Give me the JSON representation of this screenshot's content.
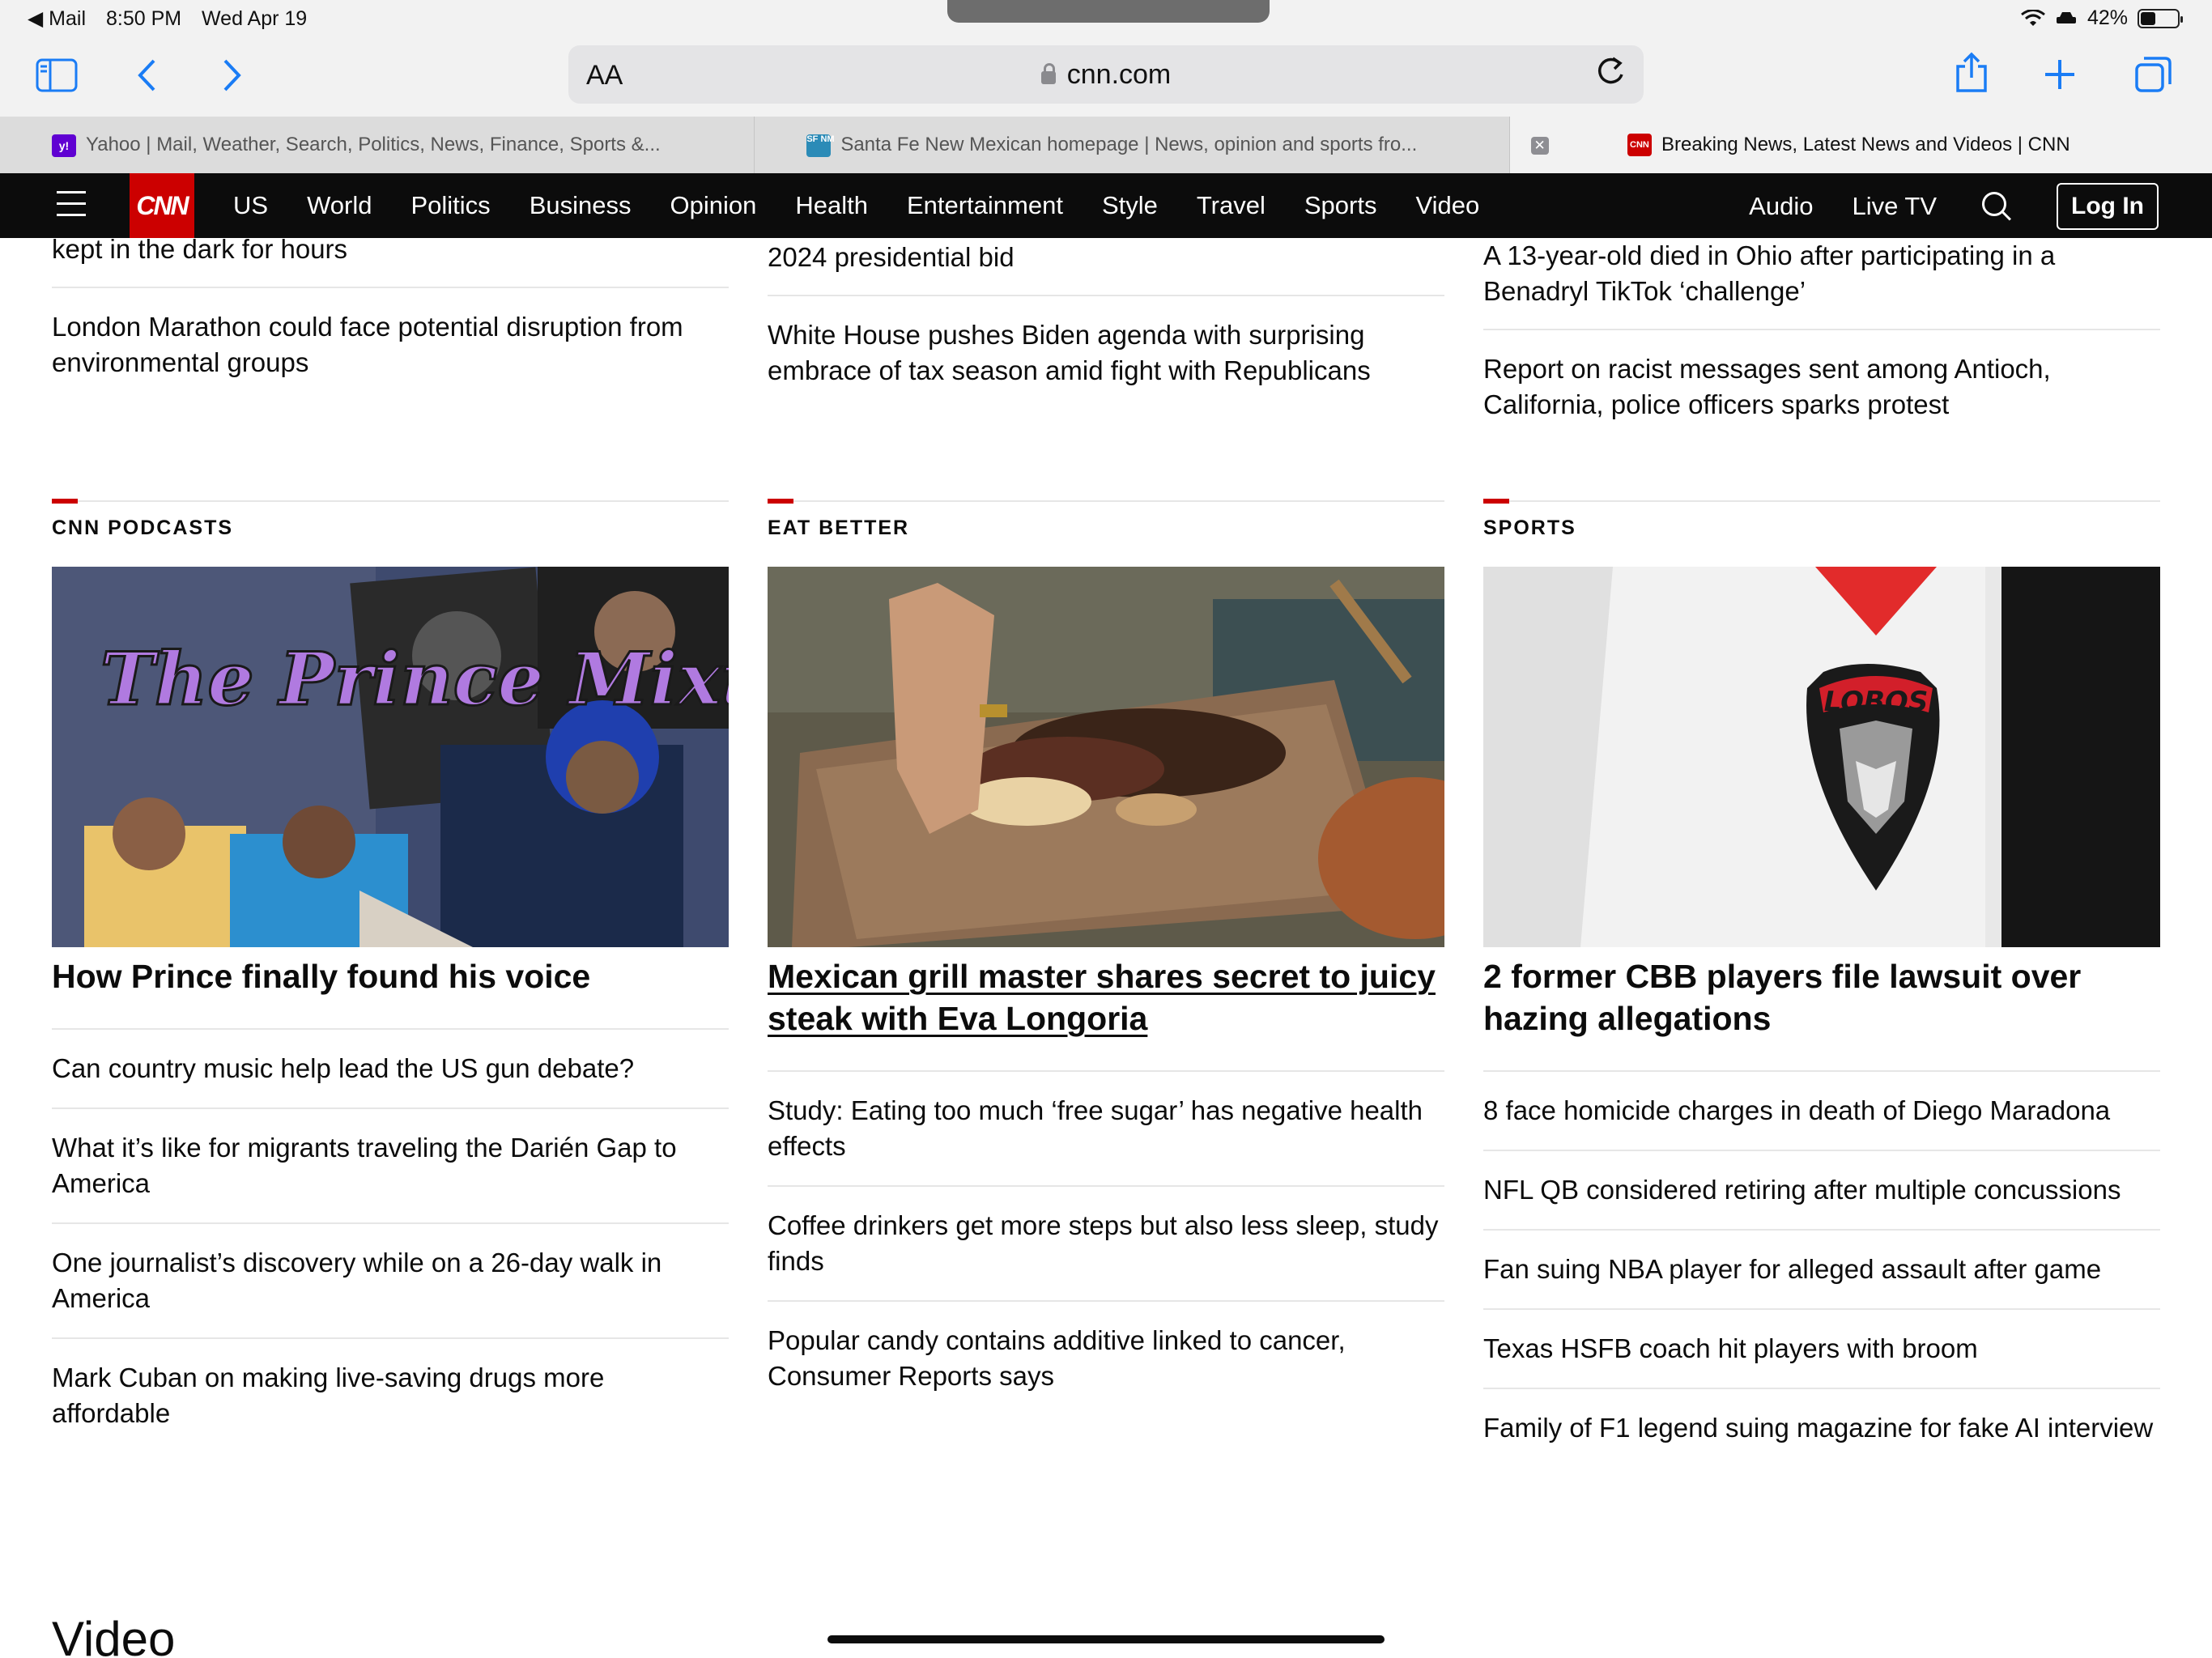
{
  "status_bar": {
    "back_app": "◀ Mail",
    "time": "8:50 PM",
    "date": "Wed Apr 19",
    "battery": "42%",
    "battery_level": 0.42
  },
  "browser": {
    "text_size_label": "AA",
    "url": "cnn.com",
    "tabs": [
      {
        "title": "Yahoo | Mail, Weather, Search, Politics, News, Finance, Sports &...",
        "favicon": "y!",
        "favicon_color": "#6001d2"
      },
      {
        "title": "Santa Fe New Mexican homepage | News, opinion and sports fro...",
        "favicon": "SF NM",
        "favicon_color": "#2b8bb7"
      },
      {
        "title": "Breaking News, Latest News and Videos | CNN",
        "favicon": "CNN",
        "favicon_color": "#cc0000"
      }
    ],
    "tab_close": "✕"
  },
  "nav": {
    "logo": "CNN",
    "links": [
      "US",
      "World",
      "Politics",
      "Business",
      "Opinion",
      "Health",
      "Entertainment",
      "Style",
      "Travel",
      "Sports",
      "Video"
    ],
    "audio": "Audio",
    "live_tv": "Live TV",
    "login": "Log In"
  },
  "top_links": {
    "col1": [
      "kept in the dark for hours",
      "London Marathon could face potential disruption from environmental groups"
    ],
    "col2": [
      "2024 presidential bid",
      "White House pushes Biden agenda with surprising embrace of tax season amid fight with Republicans"
    ],
    "col3": [
      "A 13-year-old died in Ohio after participating in a Benadryl TikTok ‘challenge’",
      "Report on racist messages sent among Antioch, California, police officers sparks protest"
    ]
  },
  "sections": [
    {
      "label": "CNN PODCASTS",
      "headline": "How Prince finally found his voice",
      "image_alt": "The Prince Mixtape",
      "items": [
        "Can country music help lead the US gun debate?",
        "What it’s like for migrants traveling the Darién Gap to America",
        "One journalist’s discovery while on a 26-day walk in America",
        "Mark Cuban on making live-saving drugs more affordable"
      ]
    },
    {
      "label": "EAT BETTER",
      "headline": "Mexican grill master shares secret to juicy steak with Eva Longoria",
      "items": [
        "Study: Eating too much ‘free sugar’ has negative health effects",
        "Coffee drinkers get more steps but also less sleep, study finds",
        "Popular candy contains additive linked to cancer, Consumer Reports says"
      ]
    },
    {
      "label": "SPORTS",
      "headline": "2 former CBB players file lawsuit over hazing allegations",
      "image_alt": "LOBOS",
      "items": [
        "8 face homicide charges in death of Diego Maradona",
        "NFL QB considered retiring after multiple concussions",
        "Fan suing NBA player for alleged assault after game",
        "Texas HSFB coach hit players with broom",
        "Family of F1 legend suing magazine for fake AI interview"
      ]
    }
  ],
  "video_section_title": "Video",
  "colors": {
    "cnn_red": "#cc0000",
    "nav_bg": "#0c0c0c",
    "safari_blue": "#1a7cf5"
  }
}
